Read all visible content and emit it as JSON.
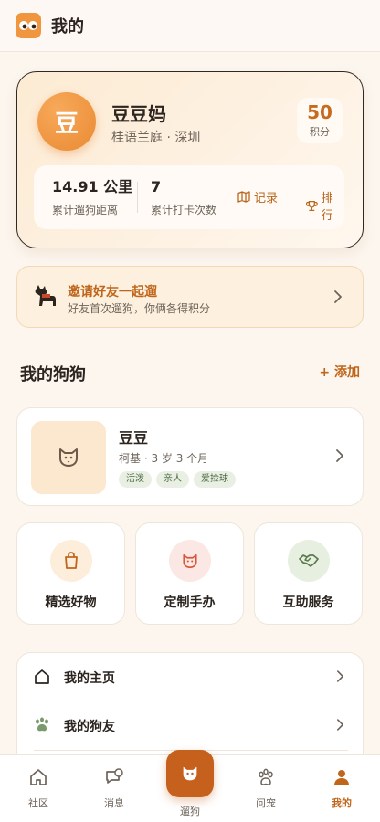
{
  "header": {
    "title": "我的",
    "logo_icon": "eyes-logo-icon"
  },
  "profile": {
    "avatar_char": "豆",
    "name": "豆豆妈",
    "location": "桂语兰庭 · 深圳",
    "points_value": "50",
    "points_label": "积分",
    "stats": {
      "distance_value": "14.91 公里",
      "distance_label": "累计遛狗距离",
      "checkins_value": "7",
      "checkins_label": "累计打卡次数",
      "records_label": "记录",
      "ranking_label": "排行"
    }
  },
  "invite": {
    "title": "邀请好友一起遛",
    "subtitle": "好友首次遛狗，你俩各得积分"
  },
  "my_dogs": {
    "section_title": "我的狗狗",
    "add_label": "+ 添加",
    "dogs": [
      {
        "name": "豆豆",
        "info": "柯基 · 3 岁 3 个月",
        "tags": [
          "活泼",
          "亲人",
          "爱捡球"
        ]
      }
    ]
  },
  "services": [
    {
      "label": "精选好物",
      "icon": "shopping-bag-icon"
    },
    {
      "label": "定制手办",
      "icon": "dog-face-icon"
    },
    {
      "label": "互助服务",
      "icon": "handshake-icon"
    }
  ],
  "menu": [
    {
      "label": "我的主页",
      "icon": "home-icon"
    },
    {
      "label": "我的狗友",
      "icon": "paw-icon"
    }
  ],
  "tabbar": {
    "tabs": [
      {
        "label": "社区",
        "icon": "home-icon"
      },
      {
        "label": "消息",
        "icon": "chat-icon"
      },
      {
        "label": "遛狗",
        "icon": "dog-face-icon"
      },
      {
        "label": "问宠",
        "icon": "paw-icon"
      },
      {
        "label": "我的",
        "icon": "user-icon"
      }
    ],
    "active": "我的"
  },
  "colors": {
    "accent": "#c0661c",
    "accent_dark": "#c5601d",
    "background": "#fcf6ef",
    "tag_green": "#e9f0e3"
  }
}
